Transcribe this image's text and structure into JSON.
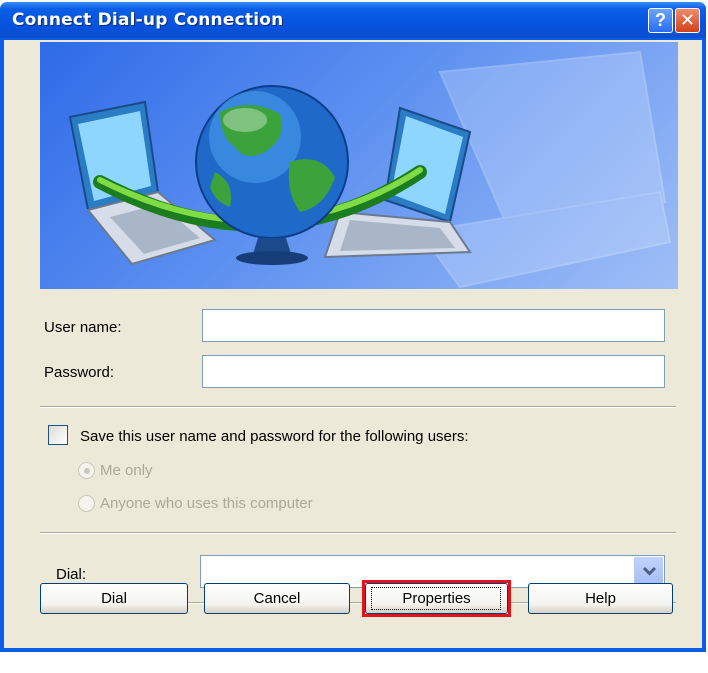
{
  "window": {
    "title": "Connect Dial-up Connection",
    "help_glyph": "?",
    "close_glyph": "✕"
  },
  "form": {
    "username_label": "User name:",
    "username_value": "",
    "password_label": "Password:",
    "password_value": ""
  },
  "save": {
    "label": "Save this user name and password for the following users:",
    "checked": false,
    "options": [
      {
        "label": "Me only",
        "selected": true,
        "enabled": false
      },
      {
        "label": "Anyone who uses this computer",
        "selected": false,
        "enabled": false
      }
    ]
  },
  "dial": {
    "label": "Dial:",
    "value": ""
  },
  "buttons": {
    "dial": "Dial",
    "cancel": "Cancel",
    "properties": "Properties",
    "help": "Help"
  },
  "colors": {
    "title_bar": "#0553df",
    "client_bg": "#ece9d8",
    "highlight": "#e3131b"
  }
}
